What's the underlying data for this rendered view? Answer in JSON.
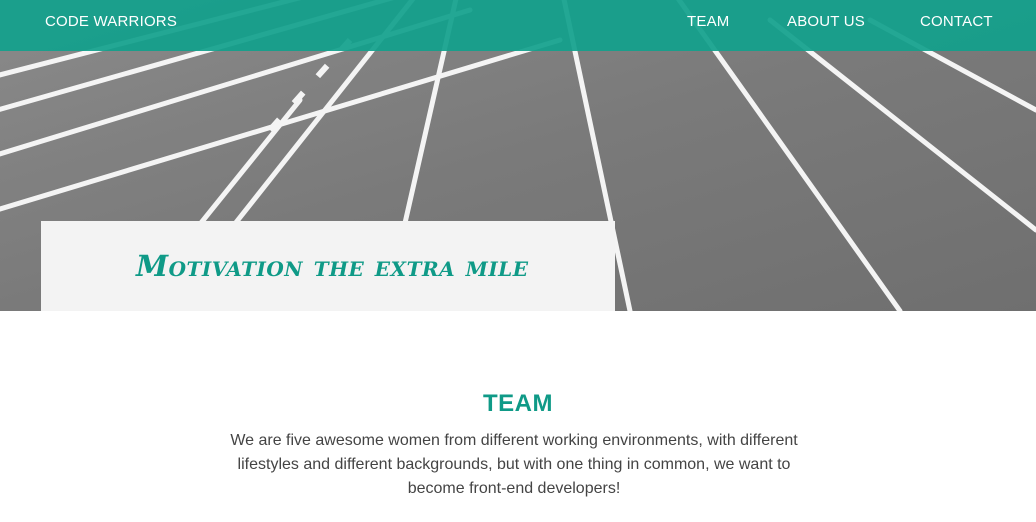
{
  "nav": {
    "brand": "CODE WARRIORS",
    "links": [
      "TEAM",
      "ABOUT US",
      "CONTACT"
    ]
  },
  "hero": {
    "tagline": "Motivation the extra mile",
    "image": "running-track-lanes"
  },
  "team": {
    "heading": "TEAM",
    "description": "We are five awesome women from different working environments, with different lifestyles and different backgrounds, but with one thing in common, we want to become front-end developers!"
  },
  "colors": {
    "accent": "#0f9a87",
    "navbar": "#12a08c",
    "track": "#7d7d7d",
    "text": "#444444"
  }
}
